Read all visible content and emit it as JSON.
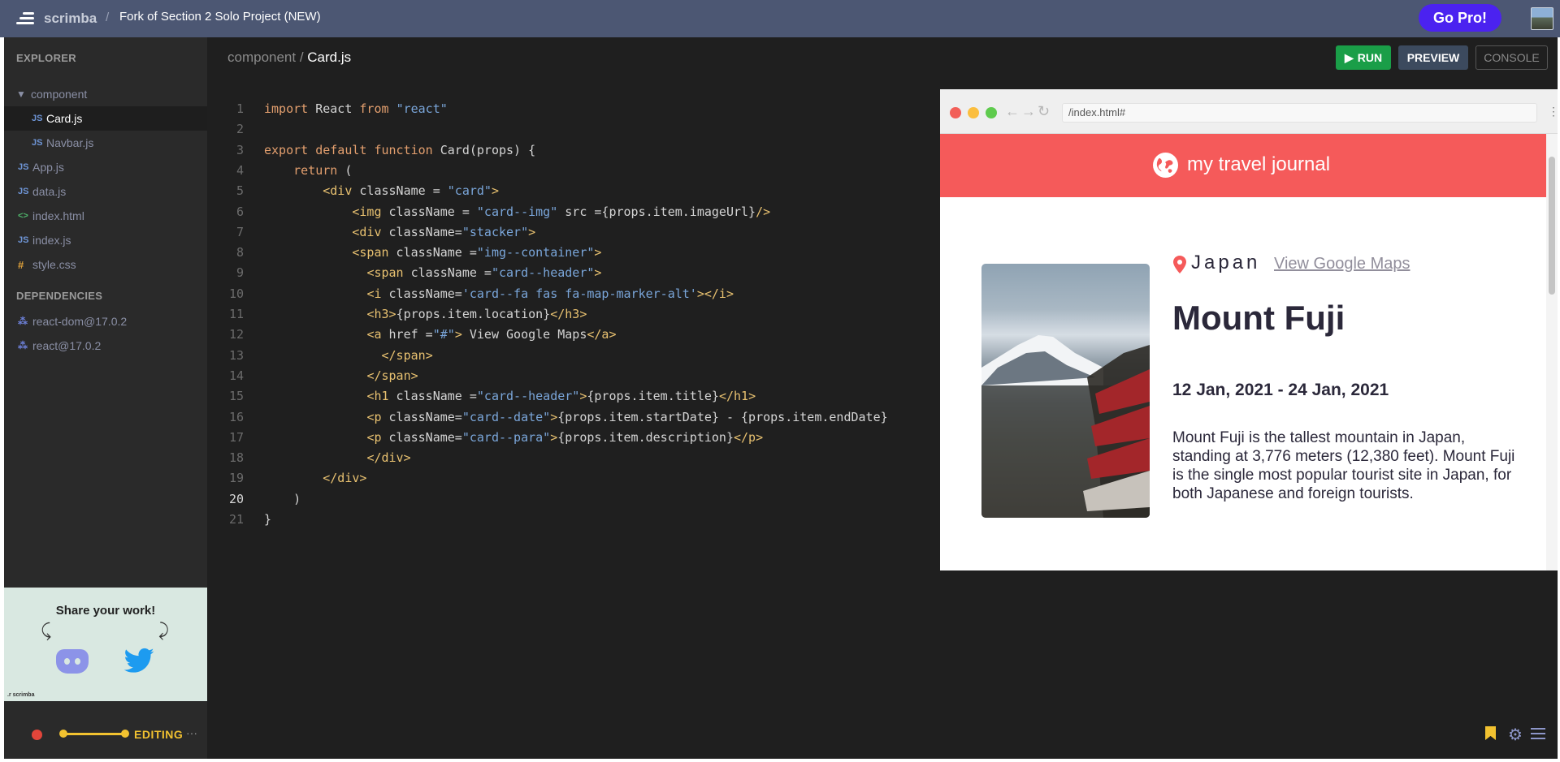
{
  "topbar": {
    "brand": "scrimba",
    "separator": "/",
    "project_title": "Fork of Section 2 Solo Project (NEW)",
    "gopro_label": "Go Pro!"
  },
  "sidebar": {
    "explorer_heading": "EXPLORER",
    "files": [
      {
        "label": "component",
        "icon": "folder-icon"
      },
      {
        "label": "Card.js",
        "icon": "JS"
      },
      {
        "label": "Navbar.js",
        "icon": "JS"
      },
      {
        "label": "App.js",
        "icon": "JS"
      },
      {
        "label": "data.js",
        "icon": "JS"
      },
      {
        "label": "index.html",
        "icon": "<>"
      },
      {
        "label": "index.js",
        "icon": "JS"
      },
      {
        "label": "style.css",
        "icon": "#"
      }
    ],
    "dependencies_heading": "DEPENDENCIES",
    "dependencies": [
      "react-dom@17.0.2",
      "react@17.0.2"
    ],
    "share": {
      "title": "Share your work!",
      "brand": ".r scrimba"
    }
  },
  "status": {
    "mode": "EDITING",
    "more": "···"
  },
  "editor": {
    "breadcrumb_folder": "component / ",
    "breadcrumb_file": "Card.js",
    "run_label": "RUN",
    "preview_label": "PREVIEW",
    "console_label": "CONSOLE",
    "current_line": 20,
    "lines": [
      "import React from \"react\"",
      "",
      "export default function Card(props) {",
      "    return (",
      "        <div className = \"card\">",
      "            <img className = \"card--img\" src ={props.item.imageUrl}/>",
      "            <div className=\"stacker\">",
      "            <span className =\"img--container\">",
      "              <span className =\"card--header\">",
      "              <i className='card--fa fas fa-map-marker-alt'></i>",
      "              <h3>{props.item.location}</h3>",
      "              <a href =\"#\"> View Google Maps</a>",
      "                </span>",
      "              </span>",
      "              <h1 className =\"card--header\">{props.item.title}</h1>",
      "              <p className=\"card--date\">{props.item.startDate} - {props.item.endDate}",
      "              <p className=\"card--para\">{props.item.description}</p>",
      "              </div>",
      "        </div>",
      "    )",
      "}"
    ]
  },
  "preview": {
    "url": "/index.html#",
    "nav_title": "my travel journal",
    "card": {
      "location": "Japan",
      "maps_link": "View Google Maps",
      "title": "Mount Fuji",
      "dates": "12 Jan, 2021 - 24 Jan, 2021",
      "description": "Mount Fuji is the tallest mountain in Japan, standing at 3,776 meters (12,380 feet). Mount Fuji is the single most popular tourist site in Japan, for both Japanese and foreign tourists."
    }
  },
  "colors": {
    "topbar": "#4c5773",
    "gopro": "#4b22f0",
    "run": "#1a9e48",
    "navbar": "#f55a5a",
    "accent_yellow": "#f2c230"
  }
}
